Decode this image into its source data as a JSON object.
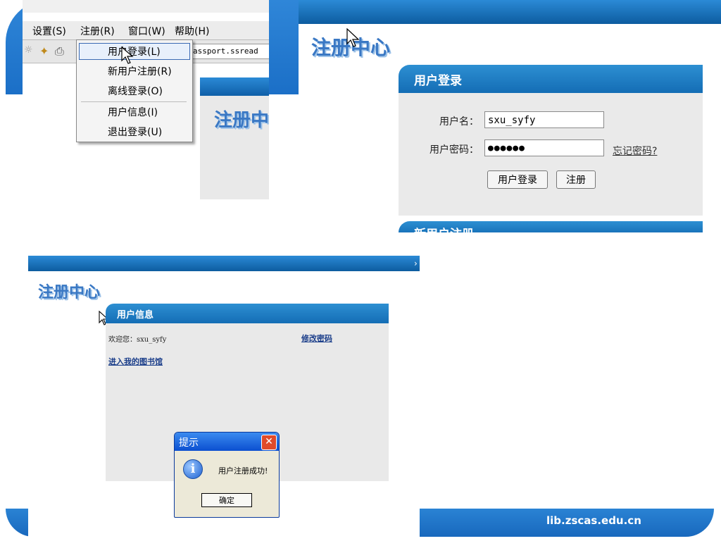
{
  "footer": {
    "url": "lib.zscas.edu.cn"
  },
  "panel1": {
    "menubar": [
      "设置(S)",
      "注册(R)",
      "窗口(W)",
      "帮助(H)"
    ],
    "address_fragment": "assport.ssread",
    "menu_items": [
      "用户登录(L)",
      "新用户注册(R)",
      "离线登录(O)",
      "用户信息(I)",
      "退出登录(U)"
    ],
    "inner_logo": "注册中"
  },
  "panel2": {
    "logo": "注册中心",
    "section_title": "用户登录",
    "username_label": "用户名：",
    "username_value": "sxu_syfy",
    "password_label": "用户密码：",
    "password_value": "●●●●●●",
    "forgot_link": "忘记密码?",
    "login_button": "用户登录",
    "register_button": "注册",
    "next_section_title": "新用户注册"
  },
  "panel3": {
    "logo": "注册中心",
    "section_title": "用户信息",
    "welcome": "欢迎您：sxu_syfy",
    "change_password": "修改密码",
    "enter_library": "进入我的图书馆",
    "dialog": {
      "title": "提示",
      "close": "✕",
      "message": "用户注册成功!",
      "ok_button": "确定"
    }
  },
  "colors": {
    "accent": "#1b6fc7",
    "header": "#146db5",
    "panel_bg": "#eaeaea"
  }
}
